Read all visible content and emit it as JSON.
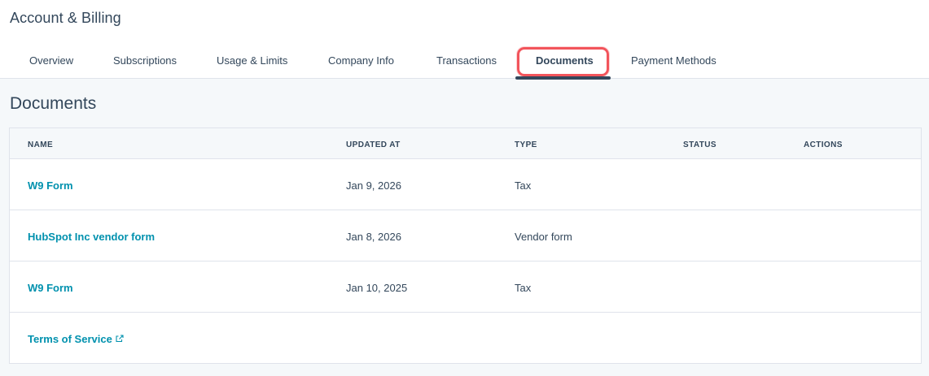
{
  "header": {
    "title": "Account & Billing"
  },
  "tabs": [
    {
      "label": "Overview",
      "active": false
    },
    {
      "label": "Subscriptions",
      "active": false
    },
    {
      "label": "Usage & Limits",
      "active": false
    },
    {
      "label": "Company Info",
      "active": false
    },
    {
      "label": "Transactions",
      "active": false
    },
    {
      "label": "Documents",
      "active": true
    },
    {
      "label": "Payment Methods",
      "active": false
    }
  ],
  "section": {
    "title": "Documents"
  },
  "table": {
    "columns": [
      "NAME",
      "UPDATED AT",
      "TYPE",
      "STATUS",
      "ACTIONS"
    ],
    "rows": [
      {
        "name": "W9 Form",
        "updated_at": "Jan 9, 2026",
        "type": "Tax",
        "status": "",
        "actions": ""
      },
      {
        "name": "HubSpot Inc vendor form",
        "updated_at": "Jan 8, 2026",
        "type": "Vendor form",
        "status": "",
        "actions": ""
      },
      {
        "name": "W9 Form",
        "updated_at": "Jan 10, 2025",
        "type": "Tax",
        "status": "",
        "actions": ""
      },
      {
        "name": "Terms of Service",
        "updated_at": "",
        "type": "",
        "status": "",
        "actions": "",
        "external_link": true
      }
    ]
  },
  "colors": {
    "link": "#0091ae",
    "text": "#33475b",
    "highlight": "#f2545b",
    "tab_underline": "#33475b"
  },
  "icons": {
    "external_link": "external-link-icon"
  }
}
